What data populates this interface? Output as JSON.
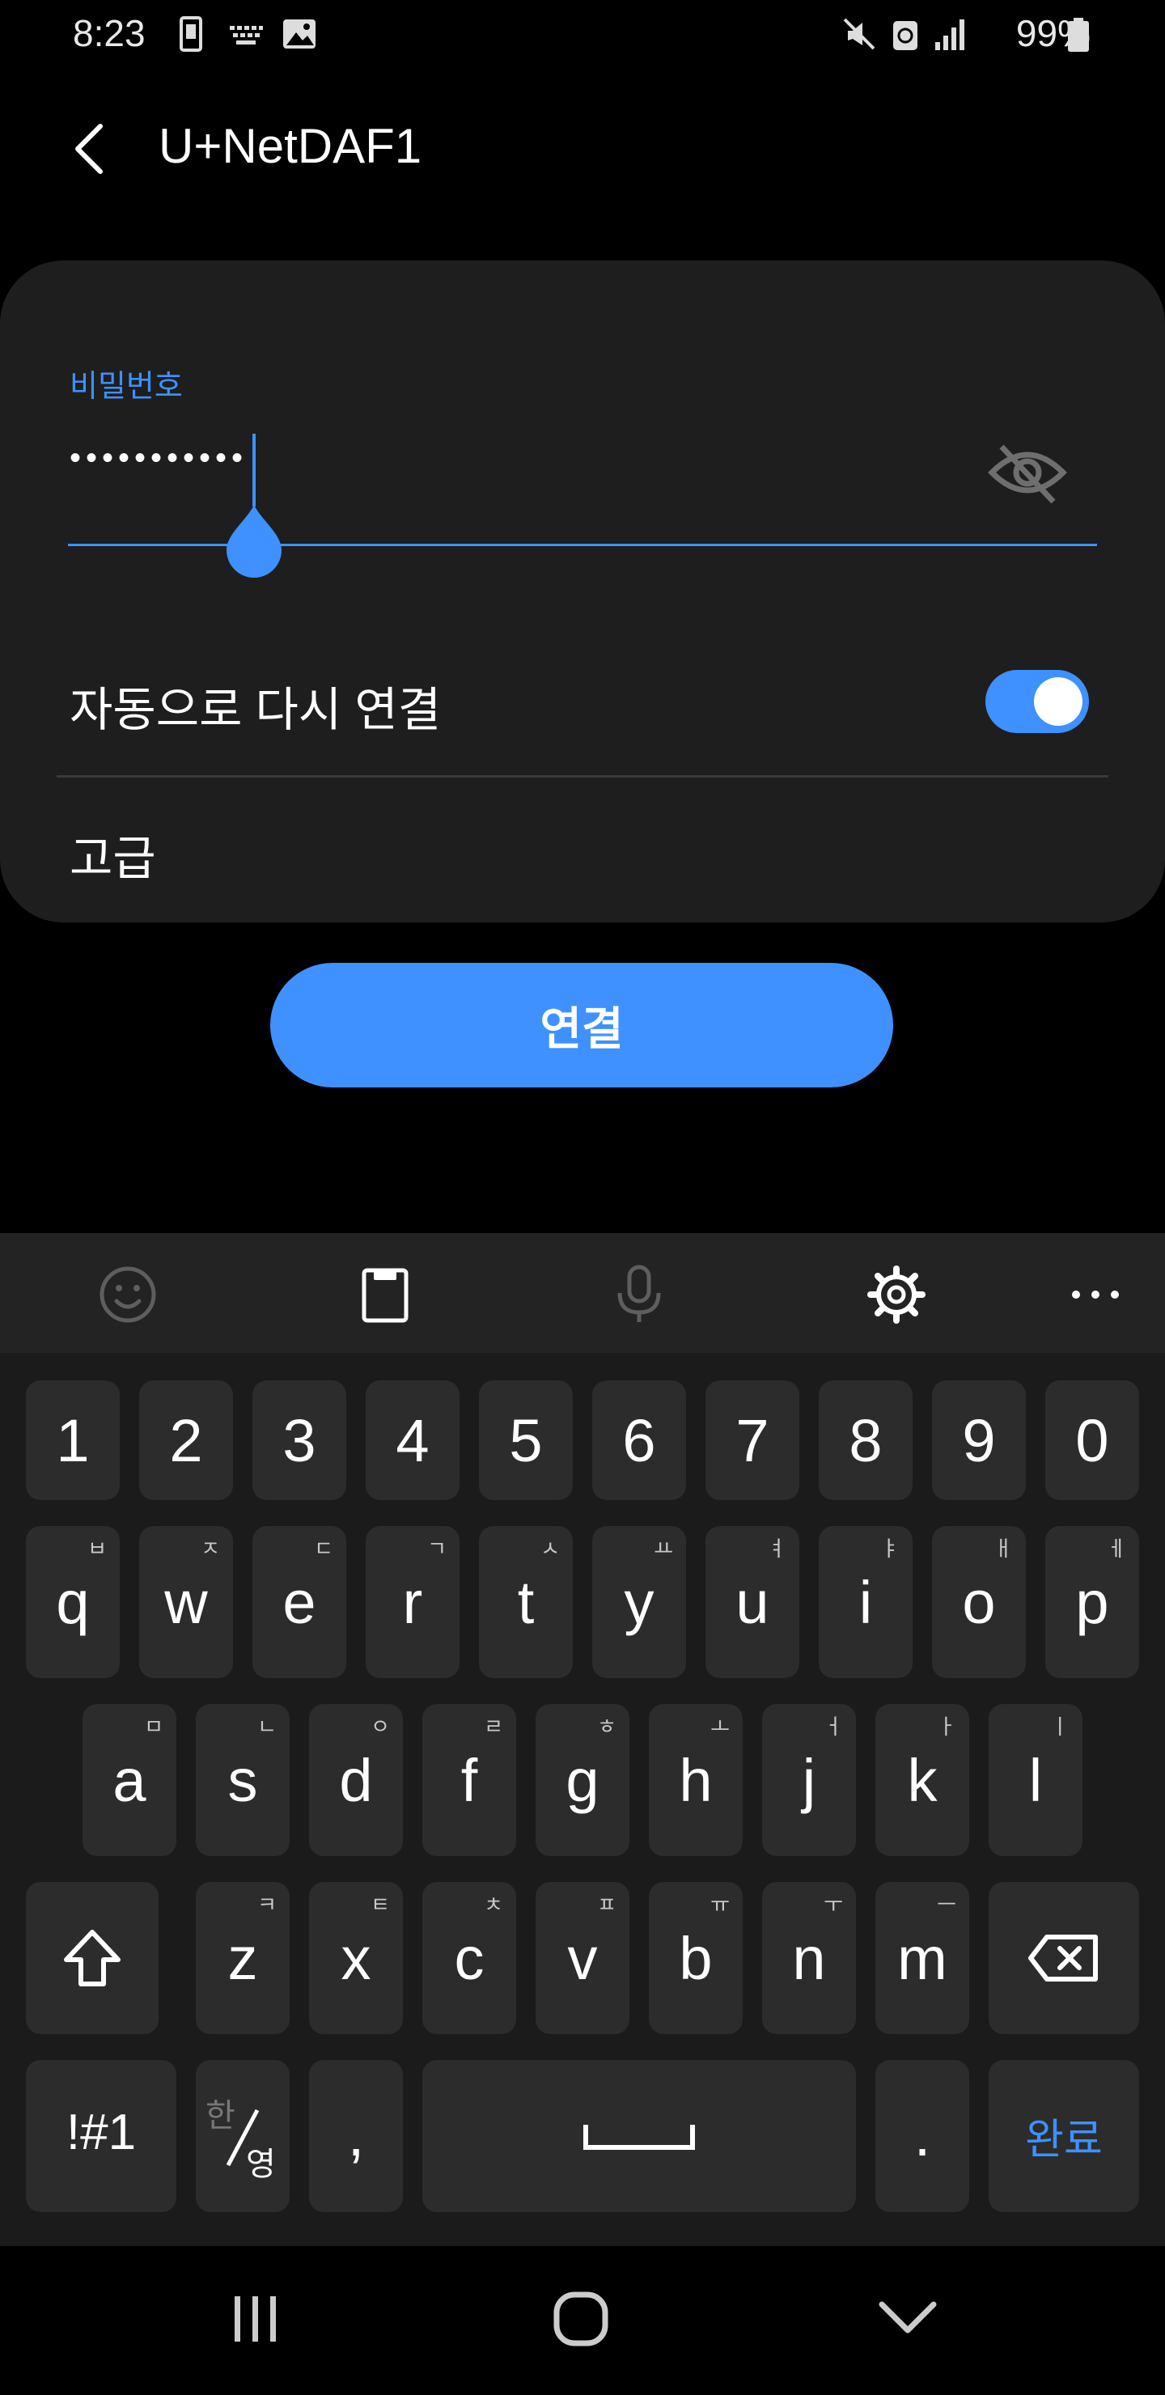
{
  "status_bar": {
    "time": "8:23",
    "battery": "99%",
    "icons": [
      "sim-icon",
      "keyboard-icon",
      "image-icon",
      "mute-icon",
      "data-saver-icon",
      "signal-icon",
      "battery-icon"
    ]
  },
  "header": {
    "title": "U+NetDAF1"
  },
  "form": {
    "password_label": "비밀번호",
    "password_value": "•••••••••••",
    "auto_reconnect_label": "자동으로 다시 연결",
    "auto_reconnect_on": true,
    "advanced_label": "고급"
  },
  "connect_button": "연결",
  "keyboard": {
    "number_row": [
      "1",
      "2",
      "3",
      "4",
      "5",
      "6",
      "7",
      "8",
      "9",
      "0"
    ],
    "row1": [
      {
        "key": "q",
        "sub": "ㅂ"
      },
      {
        "key": "w",
        "sub": "ㅈ"
      },
      {
        "key": "e",
        "sub": "ㄷ"
      },
      {
        "key": "r",
        "sub": "ㄱ"
      },
      {
        "key": "t",
        "sub": "ㅅ"
      },
      {
        "key": "y",
        "sub": "ㅛ"
      },
      {
        "key": "u",
        "sub": "ㅕ"
      },
      {
        "key": "i",
        "sub": "ㅑ"
      },
      {
        "key": "o",
        "sub": "ㅐ"
      },
      {
        "key": "p",
        "sub": "ㅔ"
      }
    ],
    "row2": [
      {
        "key": "a",
        "sub": "ㅁ"
      },
      {
        "key": "s",
        "sub": "ㄴ"
      },
      {
        "key": "d",
        "sub": "ㅇ"
      },
      {
        "key": "f",
        "sub": "ㄹ"
      },
      {
        "key": "g",
        "sub": "ㅎ"
      },
      {
        "key": "h",
        "sub": "ㅗ"
      },
      {
        "key": "j",
        "sub": "ㅓ"
      },
      {
        "key": "k",
        "sub": "ㅏ"
      },
      {
        "key": "l",
        "sub": "ㅣ"
      }
    ],
    "row3": [
      {
        "key": "z",
        "sub": "ㅋ"
      },
      {
        "key": "x",
        "sub": "ㅌ"
      },
      {
        "key": "c",
        "sub": "ㅊ"
      },
      {
        "key": "v",
        "sub": "ㅍ"
      },
      {
        "key": "b",
        "sub": "ㅠ"
      },
      {
        "key": "n",
        "sub": "ㅜ"
      },
      {
        "key": "m",
        "sub": "ㅡ"
      }
    ],
    "symbols_key": "!#1",
    "lang_key_top": "한",
    "lang_key_bottom": "영",
    "comma_key": ",",
    "period_key": ".",
    "done_key": "완료"
  },
  "colors": {
    "accent": "#3e91ff",
    "card": "#1e1e1e",
    "key": "#2c2c2c",
    "background": "#000000"
  }
}
